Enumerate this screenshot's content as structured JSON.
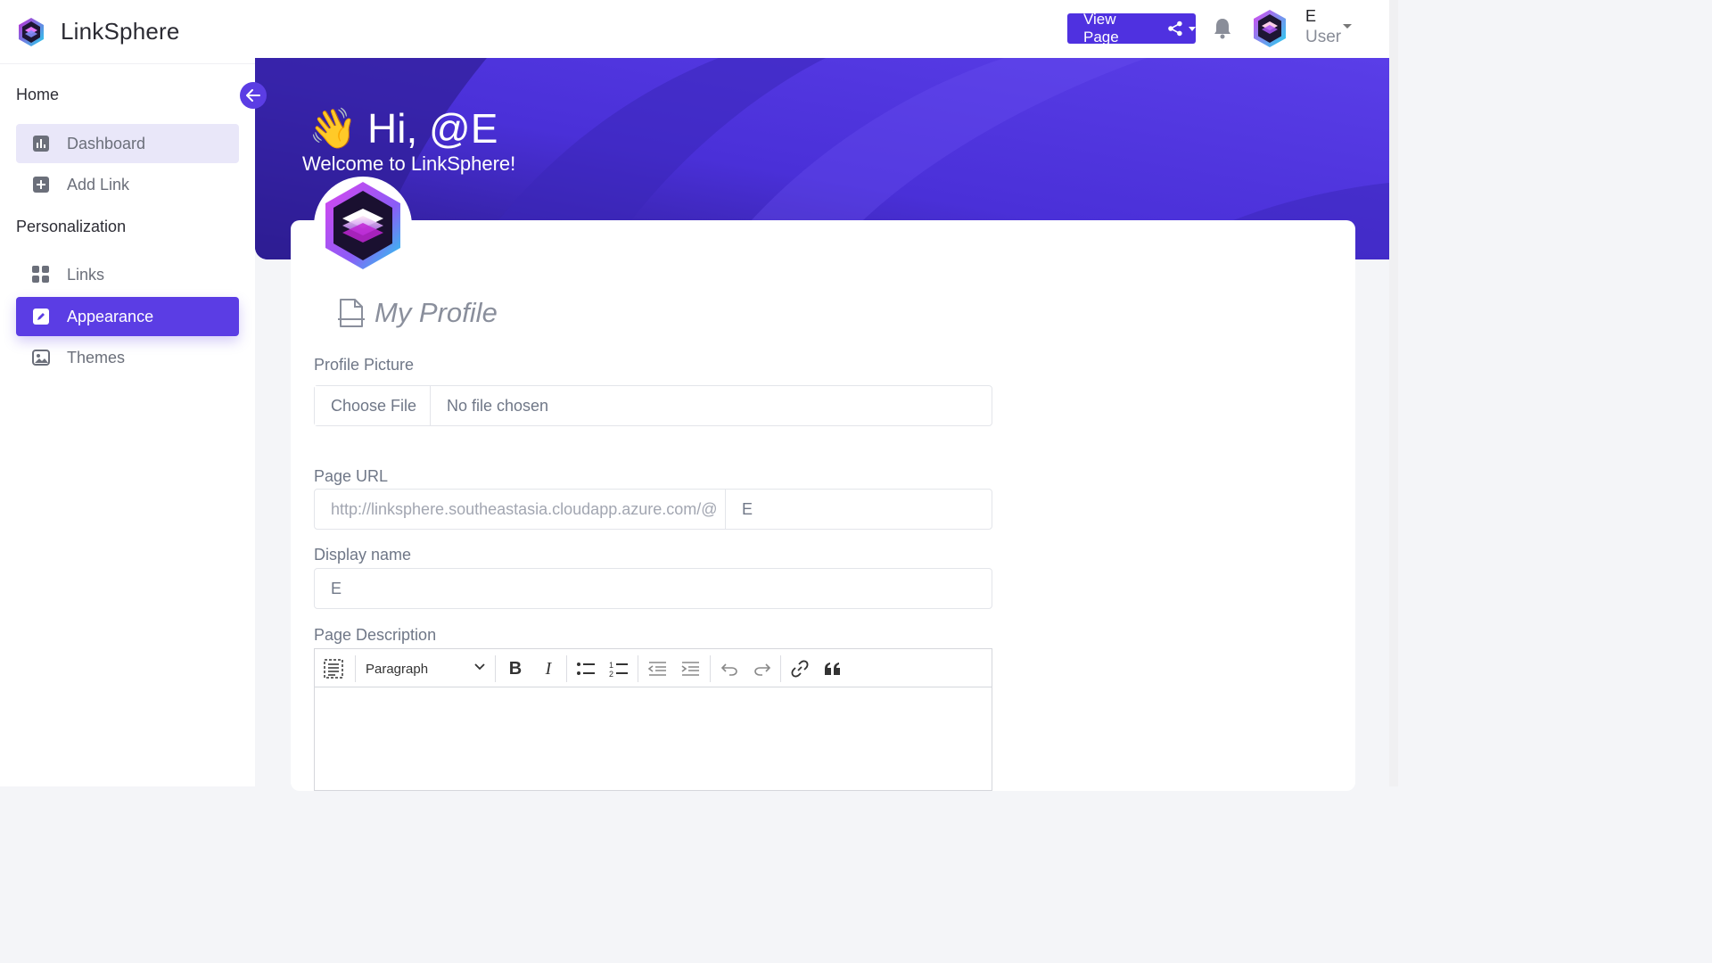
{
  "brand": {
    "name": "LinkSphere"
  },
  "sidebar": {
    "sections": [
      {
        "title": "Home"
      },
      {
        "title": "Personalization"
      }
    ],
    "items": [
      {
        "label": "Dashboard",
        "icon": "chart-bar-icon"
      },
      {
        "label": "Add Link",
        "icon": "plus-square-icon"
      },
      {
        "label": "Links",
        "icon": "grid-icon"
      },
      {
        "label": "Appearance",
        "icon": "edit-square-icon"
      },
      {
        "label": "Themes",
        "icon": "image-icon"
      }
    ],
    "active_item": "Appearance"
  },
  "topbar": {
    "view_page_label": "View Page",
    "user_initial": "E",
    "user_role": "User"
  },
  "banner": {
    "greeting": "Hi, @E",
    "wave_emoji": "👋",
    "welcome": "Welcome to LinkSphere!"
  },
  "profile": {
    "heading": "My Profile",
    "picture_label": "Profile Picture",
    "choose_file_label": "Choose File",
    "no_file_text": "No file chosen",
    "url_label": "Page URL",
    "url_prefix": "http://linksphere.southeastasia.cloudapp.azure.com/@",
    "url_value": "E",
    "display_name_label": "Display name",
    "display_name_value": "E",
    "description_label": "Page Description",
    "editor": {
      "paragraph_label": "Paragraph"
    }
  },
  "colors": {
    "accent": "#5b3de4",
    "banner": "#4f31e0",
    "sidebar_active_soft": "#e9e7f9"
  }
}
